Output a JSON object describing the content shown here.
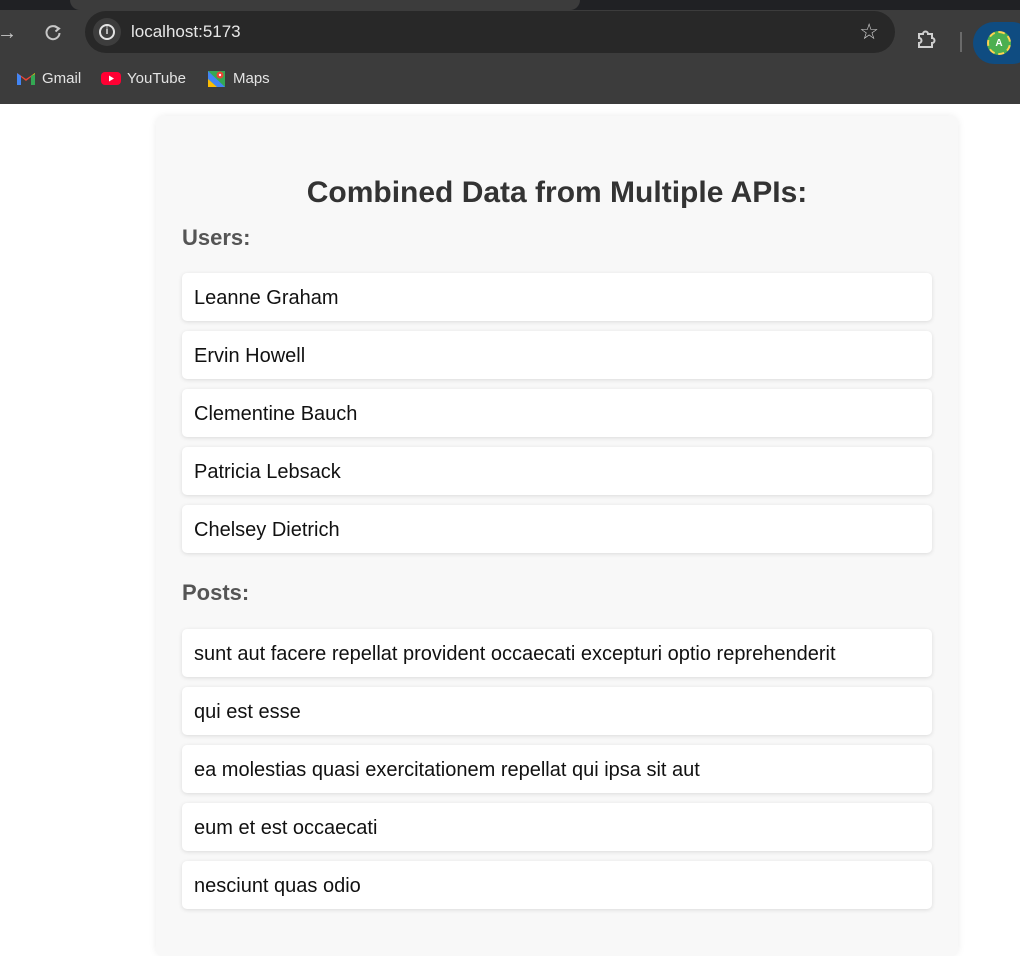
{
  "browser": {
    "url": "localhost:5173",
    "bookmarks": [
      {
        "label": "Gmail",
        "icon": "gmail-icon"
      },
      {
        "label": "YouTube",
        "icon": "youtube-icon"
      },
      {
        "label": "Maps",
        "icon": "maps-icon"
      }
    ],
    "profile_initial": "A"
  },
  "page": {
    "title": "Combined Data from Multiple APIs:",
    "users_heading": "Users:",
    "users": [
      "Leanne Graham",
      "Ervin Howell",
      "Clementine Bauch",
      "Patricia Lebsack",
      "Chelsey Dietrich"
    ],
    "posts_heading": "Posts:",
    "posts": [
      "sunt aut facere repellat provident occaecati excepturi optio reprehenderit",
      "qui est esse",
      "ea molestias quasi exercitationem repellat qui ipsa sit aut",
      "eum et est occaecati",
      "nesciunt quas odio"
    ]
  },
  "colors": {
    "chrome_bg": "#3c3c3c",
    "omnibox_bg": "#282828",
    "card_bg": "#f8f8f8",
    "heading": "#333333",
    "subheading": "#555555"
  }
}
